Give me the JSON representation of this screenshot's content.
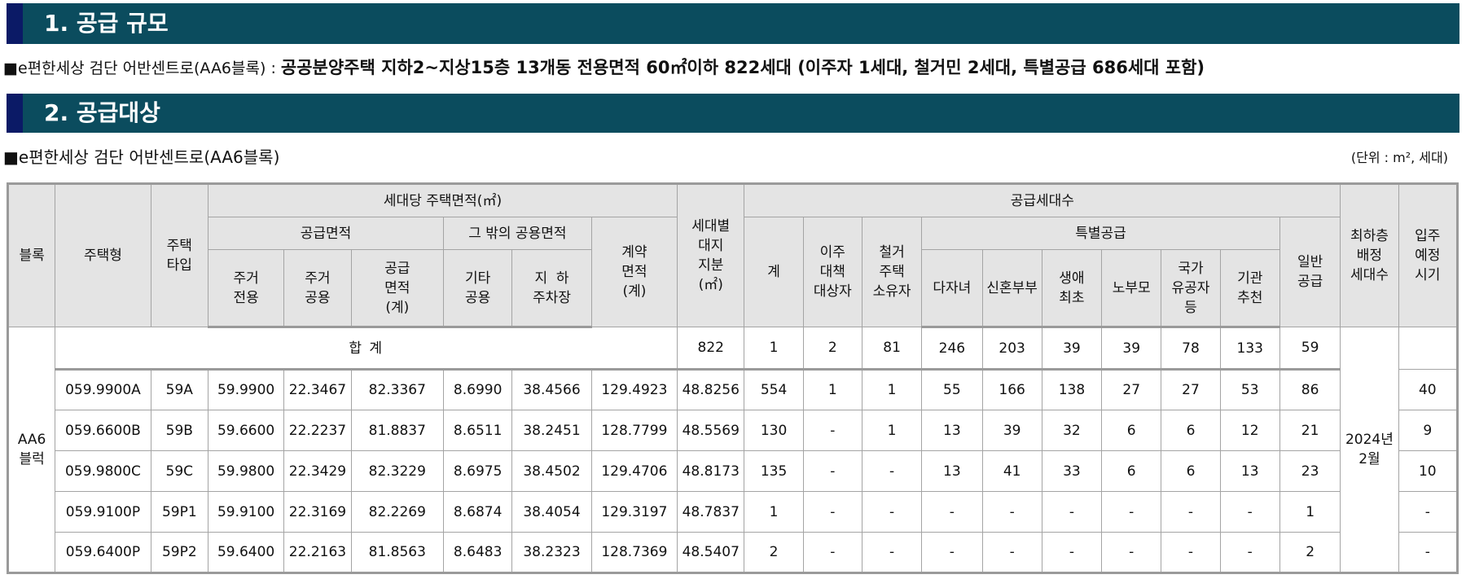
{
  "sections": {
    "s1_title": "1. 공급 규모",
    "s2_title": "2. 공급대상"
  },
  "supply_scale": {
    "complex": "■e편한세상 검단 어반센트로(AA6블록) : ",
    "detail": "공공분양주택 지하2~지상15층 13개동 전용면적 60㎡이하 822세대 (이주자 1세대, 철거민 2세대, 특별공급 686세대 포함)"
  },
  "target": {
    "complex": "■e편한세상 검단 어반센트로(AA6블록)",
    "unit_note": "(단위 : m², 세대)"
  },
  "headers": {
    "block": "블록",
    "house_type": "주택형",
    "type_code": [
      "주택",
      "타입"
    ],
    "area_per_unit": "세대당 주택면적(㎡)",
    "supply_area": "공급면적",
    "other_common": "그 밖의 공용면적",
    "contract_area": [
      "계약",
      "면적",
      "(계)"
    ],
    "land_share": [
      "세대별",
      "대지",
      "지분",
      "(㎡)"
    ],
    "supply_units": "공급세대수",
    "max_low_floor": [
      "최하층",
      "배정",
      "세대수"
    ],
    "move_in": [
      "입주",
      "예정",
      "시기"
    ],
    "exclusive": [
      "주거",
      "전용"
    ],
    "residential_common": [
      "주거",
      "공용"
    ],
    "supply_total": [
      "공급",
      "면적",
      "(계)"
    ],
    "other_common_sub": [
      "기타",
      "공용"
    ],
    "underground_parking": [
      "지  하",
      "주차장"
    ],
    "total": "계",
    "relocation": [
      "이주",
      "대책",
      "대상자"
    ],
    "demolition": [
      "철거",
      "주택",
      "소유자"
    ],
    "special": "특별공급",
    "multi_child": "다자녀",
    "newlywed": "신혼부부",
    "first_time": [
      "생애",
      "최초"
    ],
    "elderly_parents": "노부모",
    "patriots": [
      "국가",
      "유공자",
      "등"
    ],
    "institution": [
      "기관",
      "추천"
    ],
    "general": [
      "일반",
      "공급"
    ]
  },
  "table": {
    "block": [
      "AA6",
      "블럭"
    ],
    "total_label": "합  계",
    "totals": [
      "822",
      "1",
      "2",
      "81",
      "246",
      "203",
      "39",
      "39",
      "78",
      "133",
      "59"
    ],
    "move_in": [
      "2024년",
      "2월"
    ],
    "rows": [
      [
        "059.9900A",
        "59A",
        "59.9900",
        "22.3467",
        "82.3367",
        "8.6990",
        "38.4566",
        "129.4923",
        "48.8256",
        "554",
        "1",
        "1",
        "55",
        "166",
        "138",
        "27",
        "27",
        "53",
        "86",
        "40"
      ],
      [
        "059.6600B",
        "59B",
        "59.6600",
        "22.2237",
        "81.8837",
        "8.6511",
        "38.2451",
        "128.7799",
        "48.5569",
        "130",
        "-",
        "1",
        "13",
        "39",
        "32",
        "6",
        "6",
        "12",
        "21",
        "9"
      ],
      [
        "059.9800C",
        "59C",
        "59.9800",
        "22.3429",
        "82.3229",
        "8.6975",
        "38.4502",
        "129.4706",
        "48.8173",
        "135",
        "-",
        "-",
        "13",
        "41",
        "33",
        "6",
        "6",
        "13",
        "23",
        "10"
      ],
      [
        "059.9100P",
        "59P1",
        "59.9100",
        "22.3169",
        "82.2269",
        "8.6874",
        "38.4054",
        "129.3197",
        "48.7837",
        "1",
        "-",
        "-",
        "-",
        "-",
        "-",
        "-",
        "-",
        "-",
        "1",
        "-"
      ],
      [
        "059.6400P",
        "59P2",
        "59.6400",
        "22.2163",
        "81.8563",
        "8.6483",
        "38.2323",
        "128.7369",
        "48.5407",
        "2",
        "-",
        "-",
        "-",
        "-",
        "-",
        "-",
        "-",
        "-",
        "2",
        "-"
      ]
    ]
  },
  "colors": {
    "header_bar": "#0b4c5e",
    "header_accent": "#0b1a66",
    "table_header_bg": "#e4e4e4",
    "border": "#a4a4a4"
  }
}
